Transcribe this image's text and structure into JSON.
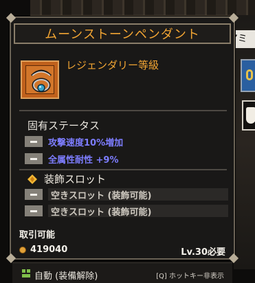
{
  "background": {
    "right_tab_label": "アミ"
  },
  "tooltip": {
    "title": "ムーンストーンペンダント",
    "grade": "レジェンダリー等級",
    "item_icon": "pendant-icon",
    "inherent_stats_label": "固有ステータス",
    "stats": [
      {
        "text": "攻撃速度10%増加"
      },
      {
        "text": "全属性耐性 +9%"
      }
    ],
    "deco_slot_label": "装飾スロット",
    "slots": [
      {
        "text": "空きスロット (装飾可能)"
      },
      {
        "text": "空きスロット (装飾可能)"
      }
    ],
    "tradable": "取引可能",
    "price": "419040",
    "level_req": "Lv.30必要"
  },
  "bottom_bar": {
    "auto_label": "自動 (装備解除)",
    "hotkey_hint": "[Q] ホットキー非表示"
  },
  "colors": {
    "title": "#f2a533",
    "stat": "#7d7dff",
    "panel": "#191817"
  }
}
